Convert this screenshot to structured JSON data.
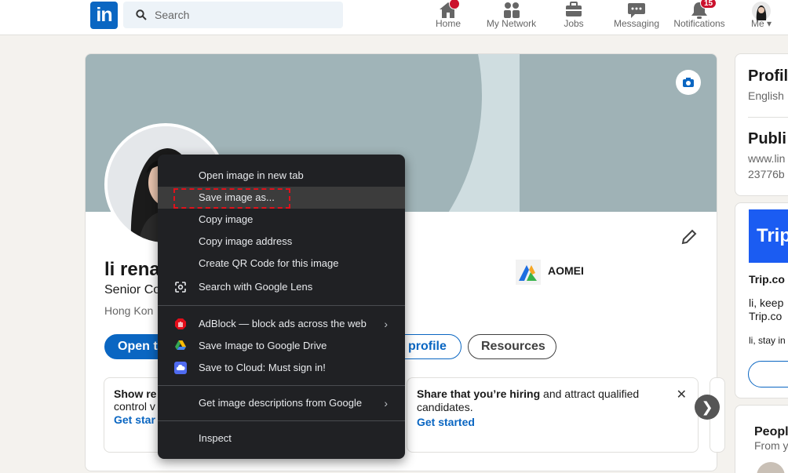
{
  "nav": {
    "logo": "in",
    "search_placeholder": "Search",
    "items": [
      {
        "label": "Home",
        "icon": "home-icon"
      },
      {
        "label": "My Network",
        "icon": "network-icon"
      },
      {
        "label": "Jobs",
        "icon": "briefcase-icon"
      },
      {
        "label": "Messaging",
        "icon": "messaging-icon"
      },
      {
        "label": "Notifications",
        "icon": "bell-icon",
        "badge": "15"
      },
      {
        "label": "Me",
        "icon": "avatar-icon"
      }
    ]
  },
  "profile": {
    "name": "li rena",
    "headline": "Senior Co",
    "location": "Hong Kon",
    "company": "AOMEI",
    "buttons": {
      "open_to": "Open t",
      "add_section": "profile",
      "resources": "Resources"
    }
  },
  "cards": {
    "left": {
      "title": "Show re",
      "body": "control v",
      "cta": "Get star"
    },
    "hiring": {
      "title_bold": "Share that you’re hiring",
      "title_rest": " and attract qualified",
      "line2": "candidates.",
      "cta": "Get started",
      "close": "✕"
    },
    "next": "❯"
  },
  "right_rail": {
    "profile_lang_title": "Profil",
    "profile_lang_value": "English",
    "public_title": "Publi",
    "public_url_1": "www.lin",
    "public_url_2": "23776b",
    "ad_logo": "Trip",
    "ad_name": "Trip.co",
    "ad_line1": "li, keep",
    "ad_line2": "Trip.co",
    "ad_line3": "li, stay in",
    "people_title": "Peopl",
    "people_sub": "From y"
  },
  "context_menu": {
    "items": [
      {
        "label": "Open image in new tab"
      },
      {
        "label": "Save image as..."
      },
      {
        "label": "Copy image"
      },
      {
        "label": "Copy image address"
      },
      {
        "label": "Create QR Code for this image"
      },
      {
        "label": "Search with Google Lens",
        "icon": "google-lens-icon"
      },
      {
        "label": "AdBlock — block ads across the web",
        "icon": "adblock-icon",
        "submenu": "›"
      },
      {
        "label": "Save Image to Google Drive",
        "icon": "google-drive-icon"
      },
      {
        "label": "Save to Cloud: Must sign in!",
        "icon": "cloud-icon"
      },
      {
        "label": "Get image descriptions from Google",
        "submenu": "›"
      },
      {
        "label": "Inspect"
      }
    ]
  },
  "colors": {
    "brand": "#0a66c2",
    "menu_bg": "#202124",
    "highlight": "#e0111b"
  }
}
